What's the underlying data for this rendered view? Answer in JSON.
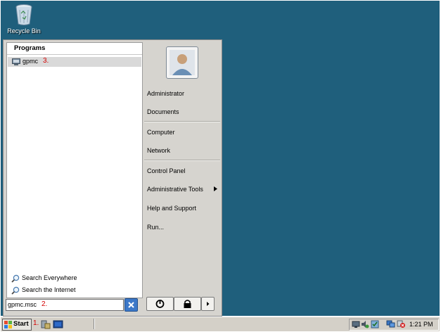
{
  "desktop": {
    "icons": [
      {
        "label": "Recycle Bin",
        "icon": "recycle-bin-icon"
      }
    ]
  },
  "start_menu": {
    "programs_header": "Programs",
    "programs": [
      {
        "label": "gpmc",
        "step": "3.",
        "icon": "gpmc-icon"
      }
    ],
    "search_links": [
      {
        "label": "Search Everywhere",
        "icon": "magnifier-icon"
      },
      {
        "label": "Search the Internet",
        "icon": "magnifier-icon"
      }
    ],
    "search_box": {
      "value": "gpmc.msc",
      "step": "2."
    },
    "right_items": [
      {
        "label": "Administrator"
      },
      {
        "label": "Documents"
      },
      {
        "label": "Computer"
      },
      {
        "label": "Network"
      },
      {
        "label": "Control Panel"
      },
      {
        "label": "Administrative Tools"
      },
      {
        "label": "Help and Support"
      },
      {
        "label": "Run..."
      }
    ],
    "power_buttons": [
      "power-icon",
      "lock-icon",
      "arrow-right-icon"
    ]
  },
  "taskbar": {
    "start_label": "Start",
    "start_step": "1.",
    "quick_launch": [
      "server-manager-icon",
      "powershell-icon"
    ],
    "tray_icons": [
      "network-icon",
      "volume-icon",
      "security-icon",
      "monitor-icon",
      "error-icon"
    ],
    "clock": "1:21 PM"
  },
  "colors": {
    "desktop": "#1f5f7c",
    "menu_bg": "#d6d4cf",
    "step_red": "#d40000",
    "highlight": "#d9d9d9"
  }
}
